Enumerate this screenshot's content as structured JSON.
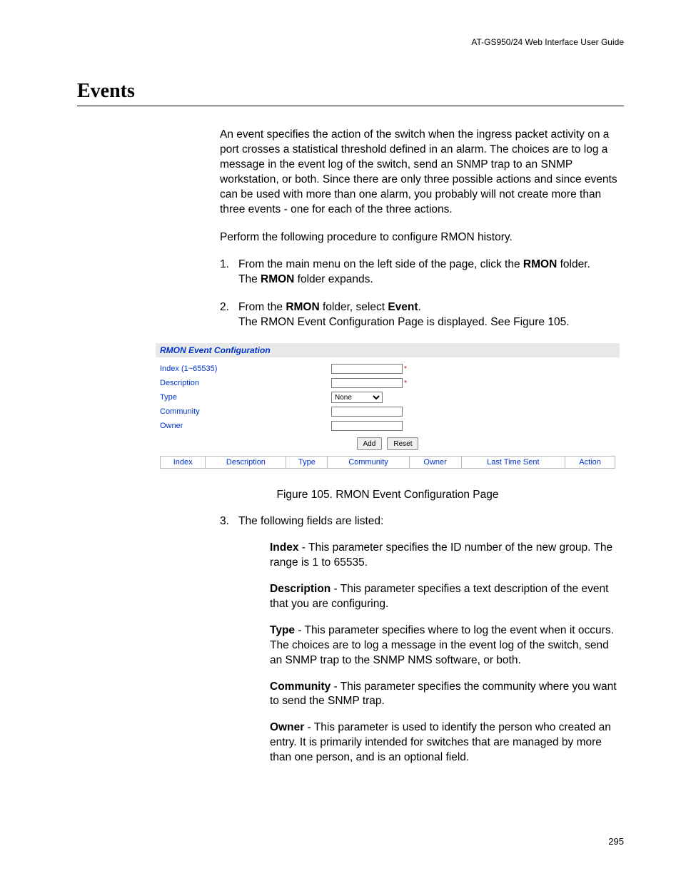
{
  "header": {
    "running": "AT-GS950/24  Web Interface User Guide"
  },
  "title": "Events",
  "body": {
    "intro": "An event specifies the action of the switch when the ingress packet activity on a port crosses a statistical threshold defined in an alarm. The choices are to log a message in the event log of the switch, send an SNMP trap to an SNMP workstation, or both. Since there are only three possible actions and since events can be used with more than one alarm, you probably will not create more than three events - one for each of the three actions.",
    "instruction": "Perform the following procedure to configure RMON history.",
    "steps": {
      "s1_num": "1.",
      "s1_a": "From the main menu on the left side of the page, click the ",
      "s1_b_bold": "RMON",
      "s1_c": " folder.",
      "s1_line2a": "The ",
      "s1_line2b_bold": "RMON",
      "s1_line2c": " folder expands.",
      "s2_num": "2.",
      "s2_a": "From the ",
      "s2_b_bold": "RMON",
      "s2_c": " folder, select ",
      "s2_d_bold": "Event",
      "s2_e": ".",
      "s2_line2": "The RMON Event Configuration Page is displayed. See Figure 105.",
      "s3_num": "3.",
      "s3_text": "The following fields are listed:"
    },
    "fields": {
      "index_label": "Index",
      "index_text": " - This parameter specifies the ID number of the new group. The range is 1 to 65535.",
      "desc_label": "Description",
      "desc_text": " - This parameter specifies a text description of the event that you are configuring.",
      "type_label": "Type",
      "type_text": " - This parameter specifies where to log the event when it occurs. The choices are to log a message in the event log of the switch, send an SNMP trap to the SNMP NMS software, or both.",
      "community_label": "Community",
      "community_text": " - This parameter specifies the community where you want to send the SNMP trap.",
      "owner_label": "Owner",
      "owner_text": " - This parameter is used to identify the person who created an entry. It is primarily intended for switches that are managed by more than one person, and is an optional field."
    }
  },
  "figure": {
    "panel_title": "RMON Event Configuration",
    "labels": {
      "index": "Index (1~65535)",
      "description": "Description",
      "type": "Type",
      "community": "Community",
      "owner": "Owner"
    },
    "type_value": "None",
    "buttons": {
      "add": "Add",
      "reset": "Reset"
    },
    "table_headers": [
      "Index",
      "Description",
      "Type",
      "Community",
      "Owner",
      "Last Time Sent",
      "Action"
    ],
    "caption": "Figure 105. RMON Event Configuration Page"
  },
  "page_number": "295"
}
